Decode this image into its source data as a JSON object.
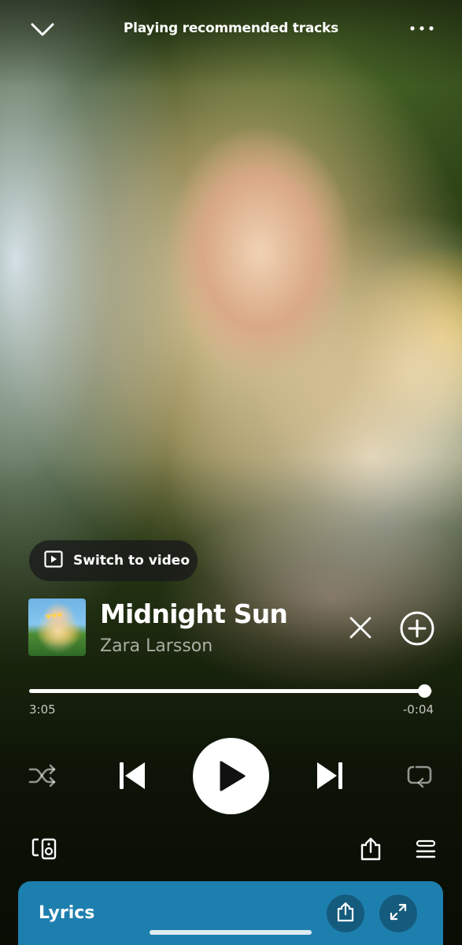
{
  "header": {
    "context_title": "Playing recommended tracks",
    "collapse_icon": "chevron-down-icon",
    "more_icon": "more-options-icon"
  },
  "video_switch": {
    "label": "Switch to video",
    "icon": "video-icon"
  },
  "track": {
    "title": "Midnight Sun",
    "artist": "Zara Larsson",
    "cover_icon": "album-cover",
    "dismiss_icon": "close-icon",
    "add_icon": "add-circle-icon"
  },
  "progress": {
    "elapsed": "3:05",
    "remaining": "-0:04",
    "fraction": 0.98
  },
  "controls": {
    "shuffle_icon": "shuffle-icon",
    "previous_icon": "skip-previous-icon",
    "play_icon": "play-icon",
    "next_icon": "skip-next-icon",
    "repeat_icon": "repeat-icon"
  },
  "actions": {
    "devices_icon": "connect-device-icon",
    "share_icon": "share-icon",
    "queue_icon": "queue-icon"
  },
  "lyrics": {
    "label": "Lyrics",
    "share_icon": "share-icon",
    "expand_icon": "expand-icon"
  },
  "colors": {
    "lyrics_card": "#1d7fae",
    "primary_text": "#ffffff",
    "secondary_text": "rgba(255,255,255,0.62)"
  }
}
